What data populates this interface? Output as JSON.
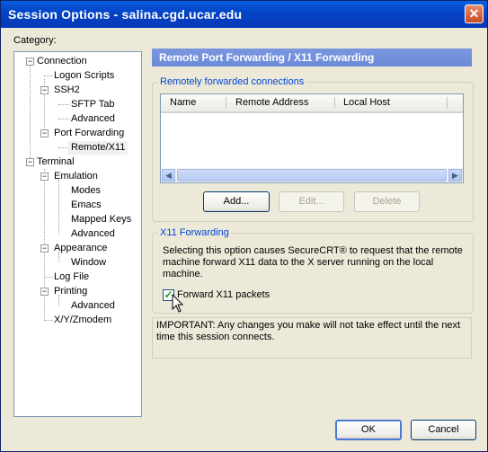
{
  "window": {
    "title": "Session Options - salina.cgd.ucar.edu",
    "close_glyph": "✕"
  },
  "category_label": "Category:",
  "tree": {
    "items": [
      {
        "label": "Connection"
      },
      {
        "label": "Logon Scripts"
      },
      {
        "label": "SSH2"
      },
      {
        "label": "SFTP Tab"
      },
      {
        "label": "Advanced"
      },
      {
        "label": "Port Forwarding"
      },
      {
        "label": "Remote/X11"
      },
      {
        "label": "Terminal"
      },
      {
        "label": "Emulation"
      },
      {
        "label": "Modes"
      },
      {
        "label": "Emacs"
      },
      {
        "label": "Mapped Keys"
      },
      {
        "label": "Advanced"
      },
      {
        "label": "Appearance"
      },
      {
        "label": "Window"
      },
      {
        "label": "Log File"
      },
      {
        "label": "Printing"
      },
      {
        "label": "Advanced"
      },
      {
        "label": "X/Y/Zmodem"
      }
    ],
    "selected": "Remote/X11"
  },
  "panel": {
    "title": "Remote Port Forwarding / X11 Forwarding"
  },
  "remote_group": {
    "label": "Remotely forwarded connections",
    "columns": [
      "Name",
      "Remote Address",
      "Local Host"
    ],
    "add_label": "Add...",
    "edit_label": "Edit...",
    "delete_label": "Delete"
  },
  "x11_group": {
    "label": "X11 Forwarding",
    "description": "Selecting this option causes SecureCRT® to request that the remote machine forward X11 data to the X server running on the local machine.",
    "checkbox_label": "Forward X11 packets",
    "checkbox_checked": true
  },
  "note": "IMPORTANT: Any changes you make will not take effect until the next time this session connects.",
  "footer": {
    "ok_label": "OK",
    "cancel_label": "Cancel"
  }
}
